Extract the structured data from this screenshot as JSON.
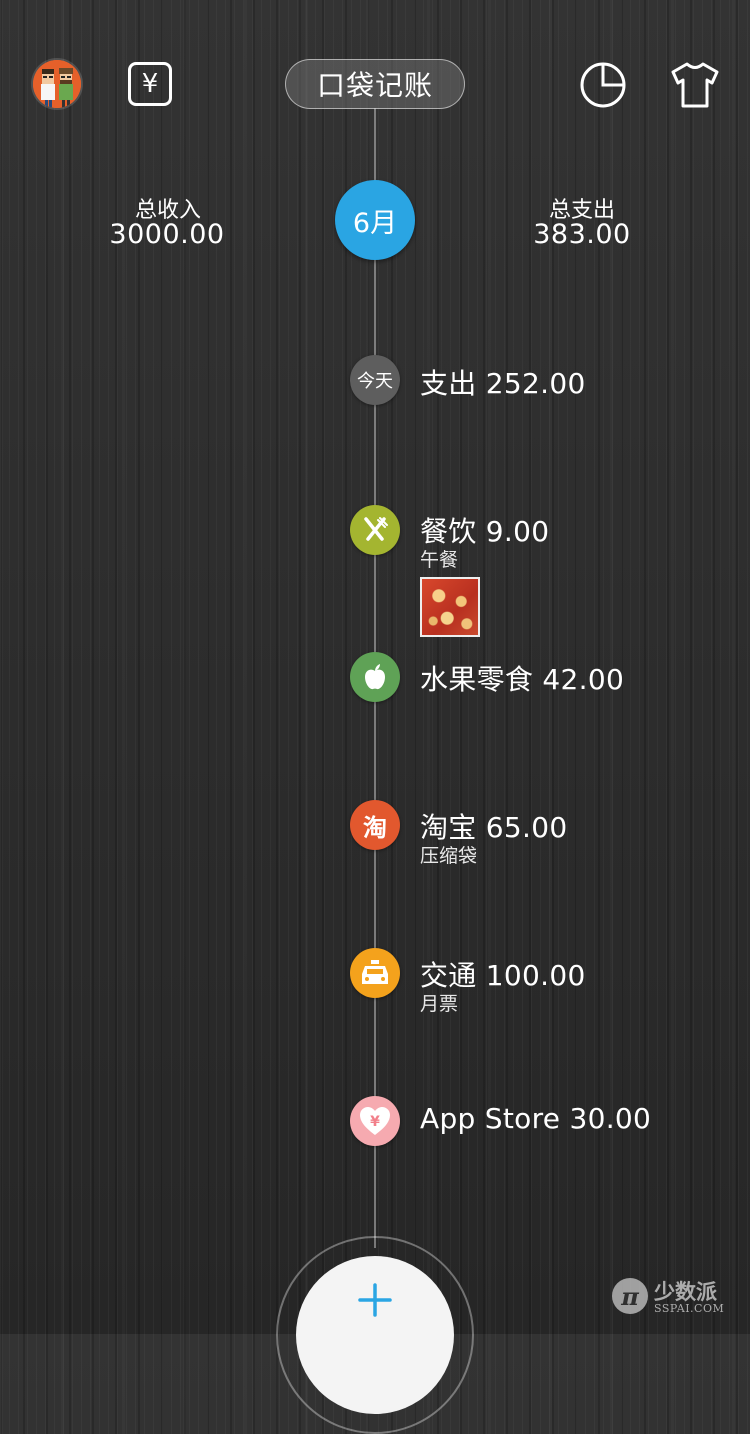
{
  "header": {
    "title": "口袋记账",
    "yen_symbol": "¥",
    "avatar_icon": "avatar-icon",
    "chart_icon": "pie-chart-icon",
    "skin_icon": "tshirt-icon"
  },
  "summary": {
    "income_label": "总收入",
    "income_value": "3000.00",
    "expense_label": "总支出",
    "expense_value": "383.00",
    "month_label": "6月"
  },
  "day": {
    "badge": "今天",
    "title": "支出 252.00"
  },
  "entries": [
    {
      "icon": "fork-knife-icon",
      "color": "#a4b530",
      "title": "餐饮 9.00",
      "note": "午餐",
      "has_photo": true
    },
    {
      "icon": "apple-icon",
      "color": "#5fa256",
      "title": "水果零食 42.00",
      "note": ""
    },
    {
      "icon": "taobao-icon",
      "color": "#e2582e",
      "glyph": "淘",
      "title": "淘宝 65.00",
      "note": "压缩袋"
    },
    {
      "icon": "taxi-icon",
      "color": "#f4a21c",
      "title": "交通 100.00",
      "note": "月票"
    },
    {
      "icon": "heart-yen-icon",
      "color": "#f6aab0",
      "glyph": "¥",
      "title": "App Store 30.00",
      "note": ""
    }
  ],
  "add_button_icon": "plus-icon",
  "watermark": {
    "logo": "π",
    "cn": "少数派",
    "en": "SSPAI.COM"
  },
  "colors": {
    "month_blue": "#2aa5e3",
    "plus_blue": "#2aa5e3"
  }
}
